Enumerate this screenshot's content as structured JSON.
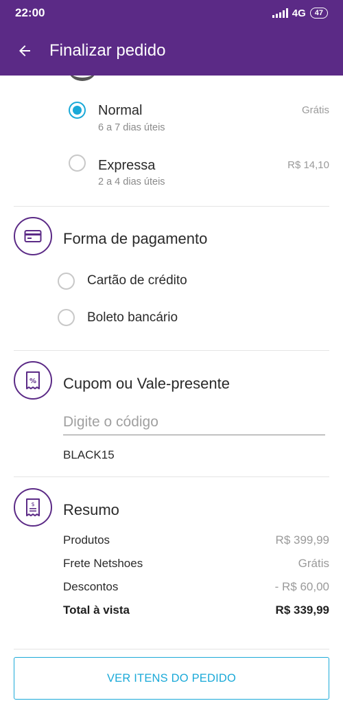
{
  "status_bar": {
    "time": "22:00",
    "network": "4G",
    "battery": "47"
  },
  "app_bar": {
    "title": "Finalizar pedido",
    "back_icon": "arrow-left-icon"
  },
  "shipping": {
    "options": [
      {
        "name": "Normal",
        "eta": "6 a 7 dias úteis",
        "price": "Grátis",
        "selected": true
      },
      {
        "name": "Expressa",
        "eta": "2 a 4 dias úteis",
        "price": "R$ 14,10",
        "selected": false
      }
    ]
  },
  "payment": {
    "title": "Forma de pagamento",
    "icon": "credit-card-icon",
    "options": [
      {
        "label": "Cartão de crédito",
        "selected": false
      },
      {
        "label": "Boleto bancário",
        "selected": false
      }
    ]
  },
  "coupon": {
    "title": "Cupom ou Vale-presente",
    "icon": "coupon-icon",
    "placeholder": "Digite o código",
    "value": "",
    "applied_code": "BLACK15"
  },
  "summary": {
    "title": "Resumo",
    "icon": "receipt-icon",
    "rows": [
      {
        "label": "Produtos",
        "value": "R$ 399,99"
      },
      {
        "label": "Frete Netshoes",
        "value": "Grátis"
      },
      {
        "label": "Descontos",
        "value": "- R$ 60,00"
      }
    ],
    "total": {
      "label": "Total à vista",
      "value": "R$ 339,99"
    }
  },
  "actions": {
    "view_items_label": "VER ITENS DO PEDIDO"
  },
  "colors": {
    "brand_purple": "#5b2a86",
    "accent_blue": "#1aa9d8"
  }
}
